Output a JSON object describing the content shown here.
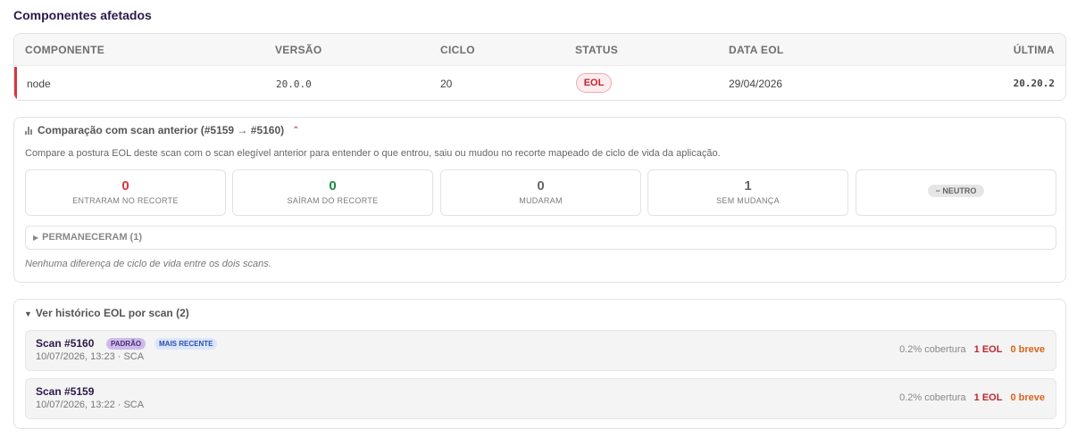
{
  "section": {
    "title": "Componentes afetados"
  },
  "components_table": {
    "headers": {
      "component": "COMPONENTE",
      "version": "VERSÃO",
      "cycle": "CICLO",
      "status": "STATUS",
      "eol_date": "DATA EOL",
      "latest": "ÚLTIMA"
    },
    "rows": [
      {
        "component": "node",
        "version": "20.0.0",
        "cycle": "20",
        "status": "EOL",
        "eol_date": "29/04/2026",
        "latest": "20.20.2"
      }
    ]
  },
  "comparison": {
    "title": "Comparação com scan anterior (#5159 → #5160)",
    "description": "Compare a postura EOL deste scan com o scan elegível anterior para entender o que entrou, saiu ou mudou no recorte mapeado de ciclo de vida da aplicação.",
    "stats": [
      {
        "value": "0",
        "label": "ENTRARAM NO RECORTE",
        "color": "#d9363e"
      },
      {
        "value": "0",
        "label": "SAÍRAM DO RECORTE",
        "color": "#1e8a45"
      },
      {
        "value": "0",
        "label": "MUDARAM",
        "color": "#666666"
      },
      {
        "value": "1",
        "label": "SEM MUDANÇA",
        "color": "#666666"
      }
    ],
    "verdict": "− NEUTRO",
    "remained": "PERMANECERAM (1)",
    "no_diff": "Nenhuma diferença de ciclo de vida entre os dois scans."
  },
  "history": {
    "title": "Ver histórico EOL por scan (2)",
    "scans": [
      {
        "name": "Scan #5160",
        "badge_default": "PADRÃO",
        "badge_recent": "MAIS RECENTE",
        "date": "10/07/2026, 13:23 · SCA",
        "coverage": "0.2% cobertura",
        "eol": "1 EOL",
        "breve": "0 breve"
      },
      {
        "name": "Scan #5159",
        "date": "10/07/2026, 13:22 · SCA",
        "coverage": "0.2% cobertura",
        "eol": "1 EOL",
        "breve": "0 breve"
      }
    ]
  }
}
